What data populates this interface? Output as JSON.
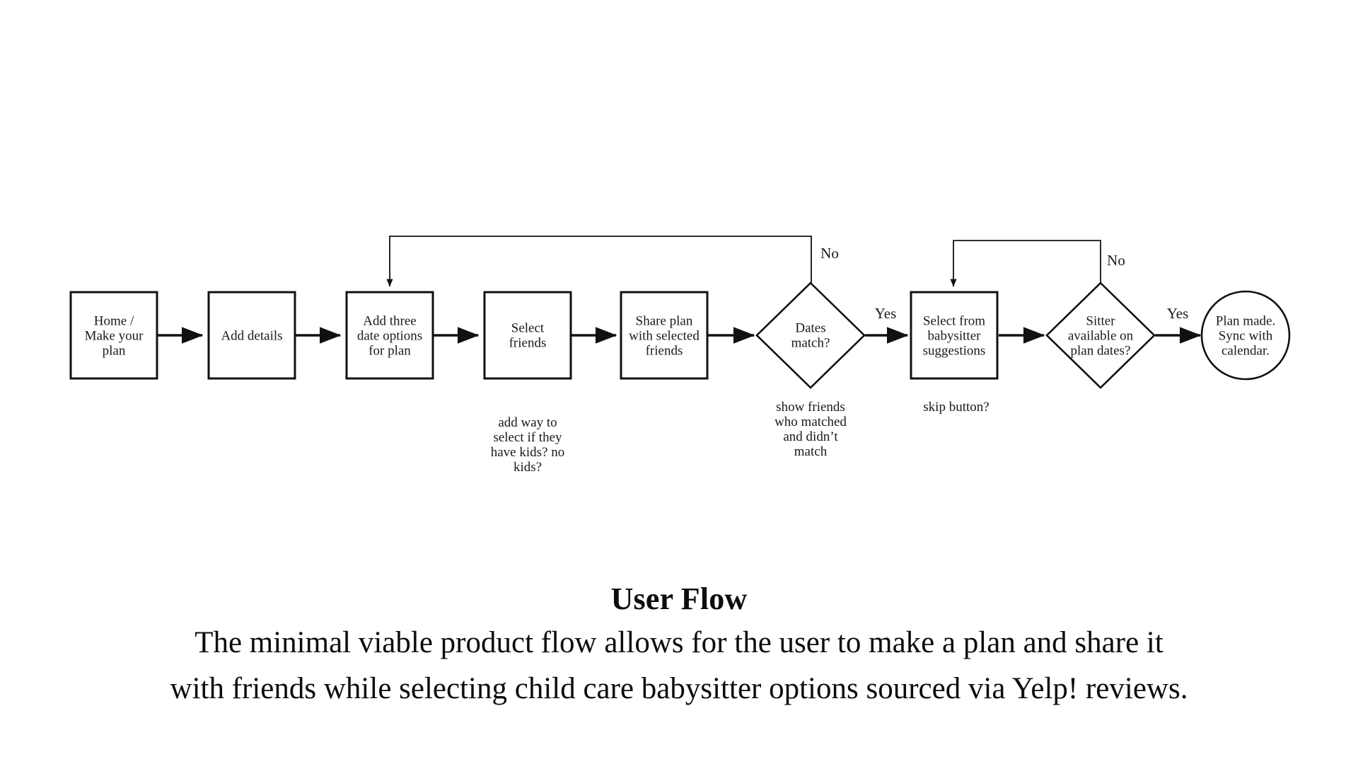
{
  "diagram": {
    "type": "flowchart",
    "orientation": "left-to-right",
    "nodes": [
      {
        "id": "home",
        "shape": "rectangle",
        "lines": [
          "Home /",
          "Make your",
          "plan"
        ]
      },
      {
        "id": "details",
        "shape": "rectangle",
        "lines": [
          "Add details"
        ]
      },
      {
        "id": "dates",
        "shape": "rectangle",
        "lines": [
          "Add three",
          "date options",
          "for plan"
        ]
      },
      {
        "id": "friends",
        "shape": "rectangle",
        "lines": [
          "Select",
          "friends"
        ]
      },
      {
        "id": "share",
        "shape": "rectangle",
        "lines": [
          "Share plan",
          "with selected",
          "friends"
        ]
      },
      {
        "id": "match",
        "shape": "diamond",
        "lines": [
          "Dates",
          "match?"
        ]
      },
      {
        "id": "sitter_sel",
        "shape": "rectangle",
        "lines": [
          "Select from",
          "babysitter",
          "suggestions"
        ]
      },
      {
        "id": "sitter_avail",
        "shape": "diamond",
        "lines": [
          "Sitter",
          "available on",
          "plan dates?"
        ]
      },
      {
        "id": "done",
        "shape": "circle",
        "lines": [
          "Plan made.",
          "Sync with",
          "calendar."
        ]
      }
    ],
    "edge_labels": {
      "match_no": "No",
      "match_yes": "Yes",
      "sitter_no": "No",
      "sitter_yes": "Yes"
    },
    "notes": [
      {
        "id": "note-friends",
        "lines": [
          "add way to",
          "select if they",
          "have kids? no",
          "kids?"
        ]
      },
      {
        "id": "note-match",
        "lines": [
          "show friends",
          "who matched",
          "and didn’t",
          "match"
        ]
      },
      {
        "id": "note-sitter",
        "lines": [
          "skip button?"
        ]
      }
    ],
    "stroke_color": "#111111",
    "fill_color": "#ffffff"
  },
  "caption": {
    "title": "User Flow",
    "line1": "The minimal viable product flow allows for the user to make a plan and share it",
    "line2": "with friends while selecting child care babysitter options sourced via Yelp! reviews."
  }
}
